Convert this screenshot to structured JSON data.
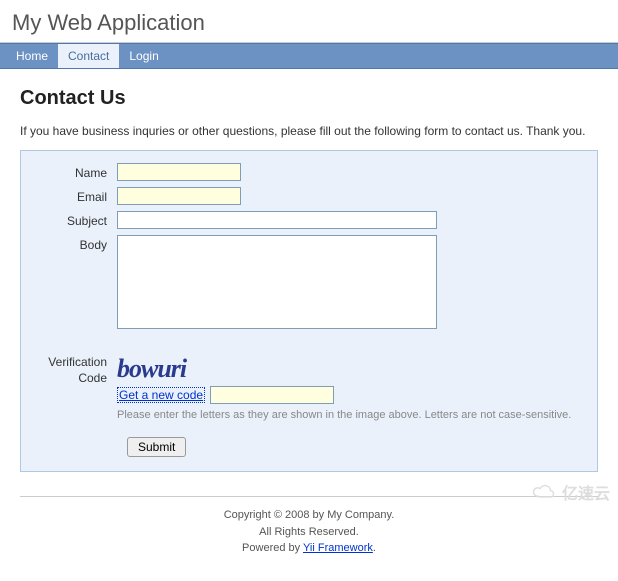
{
  "header": {
    "title": "My Web Application"
  },
  "nav": {
    "items": [
      {
        "label": "Home",
        "active": false
      },
      {
        "label": "Contact",
        "active": true
      },
      {
        "label": "Login",
        "active": false
      }
    ]
  },
  "page": {
    "heading": "Contact Us",
    "intro": "If you have business inquries or other questions, please fill out the following form to contact us. Thank you."
  },
  "form": {
    "name": {
      "label": "Name",
      "value": ""
    },
    "email": {
      "label": "Email",
      "value": ""
    },
    "subject": {
      "label": "Subject",
      "value": ""
    },
    "body": {
      "label": "Body",
      "value": ""
    },
    "captcha": {
      "label": "Verification Code",
      "image_text": "bowuri",
      "new_code_link": "Get a new code",
      "value": "",
      "hint": "Please enter the letters as they are shown in the image above. Letters are not case-sensitive."
    },
    "submit_label": "Submit"
  },
  "footer": {
    "copyright": "Copyright © 2008 by My Company.",
    "rights": "All Rights Reserved.",
    "powered_prefix": "Powered by ",
    "powered_link": "Yii Framework",
    "powered_suffix": "."
  },
  "watermark": {
    "text": "亿速云"
  }
}
